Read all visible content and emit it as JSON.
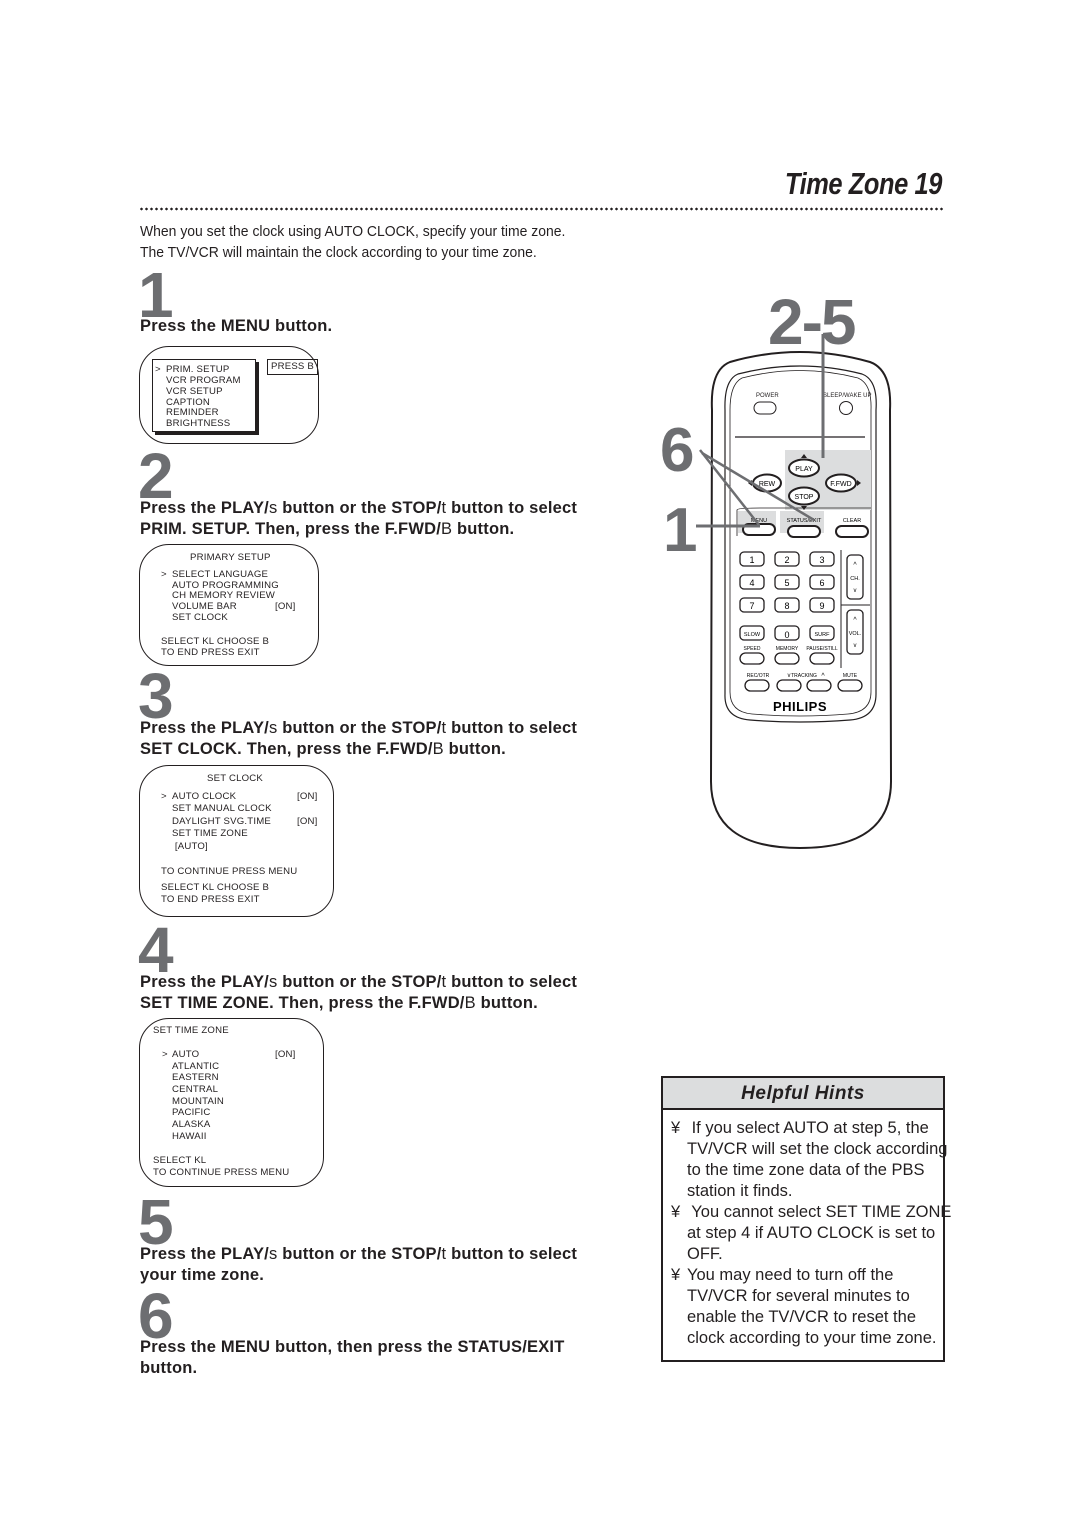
{
  "page": {
    "title": "Time Zone  19",
    "intro": [
      "When you set the clock using AUTO CLOCK, specify your time zone.",
      "The TV/VCR will maintain the clock according to your time zone."
    ]
  },
  "steps": [
    {
      "number": "1",
      "instruction_lines": [
        [
          "Press the MENU button."
        ]
      ],
      "screen": {
        "items": [
          "PRIM. SETUP",
          "VCR PROGRAM",
          "VCR SETUP",
          "CAPTION",
          "REMINDER",
          "BRIGHTNESS"
        ],
        "cursor": ">",
        "side_label": "PRESS B"
      }
    },
    {
      "number": "2",
      "instruction_lines": [
        [
          "Press the PLAY/",
          "s",
          "  button or the STOP/",
          "t",
          "  button to select"
        ],
        [
          "PRIM. SETUP.  Then, press the F.FWD/",
          "B",
          "  button."
        ]
      ],
      "screen": {
        "title": "PRIMARY SETUP",
        "cursor": ">",
        "items": [
          {
            "label": "SELECT LANGUAGE",
            "value": ""
          },
          {
            "label": "AUTO PROGRAMMING",
            "value": ""
          },
          {
            "label": "CH MEMORY REVIEW",
            "value": ""
          },
          {
            "label": "VOLUME BAR",
            "value": "[ON]"
          },
          {
            "label": "SET CLOCK",
            "value": ""
          }
        ],
        "footer": [
          "SELECT KL  CHOOSE B",
          "TO  END  PRESS  EXIT"
        ]
      }
    },
    {
      "number": "3",
      "instruction_lines": [
        [
          "Press the PLAY/",
          "s",
          "  button or the STOP/",
          "t",
          "  button to select"
        ],
        [
          "SET CLOCK. Then, press the F.FWD/",
          "B",
          "  button."
        ]
      ],
      "screen": {
        "title": "SET CLOCK",
        "cursor": ">",
        "items": [
          {
            "label": "AUTO CLOCK",
            "value": "[ON]"
          },
          {
            "label": "SET MANUAL CLOCK",
            "value": ""
          },
          {
            "label": "DAYLIGHT SVG.TIME",
            "value": "[ON]"
          },
          {
            "label": "SET TIME ZONE",
            "value": ""
          },
          {
            "label": " [AUTO]",
            "value": ""
          }
        ],
        "continue": "TO CONTINUE PRESS MENU",
        "footer": [
          "SELECT KL  CHOOSE B",
          "TO  END  PRESS  EXIT"
        ]
      }
    },
    {
      "number": "4",
      "instruction_lines": [
        [
          "Press the PLAY/",
          "s",
          "  button or the STOP/",
          "t",
          "  button to select"
        ],
        [
          "SET TIME ZONE. Then, press the F.FWD/",
          "B",
          "  button."
        ]
      ],
      "screen": {
        "title": "SET TIME ZONE",
        "cursor": ">",
        "items": [
          {
            "label": "AUTO",
            "value": "[ON]"
          },
          {
            "label": "ATLANTIC",
            "value": ""
          },
          {
            "label": "EASTERN",
            "value": ""
          },
          {
            "label": "CENTRAL",
            "value": ""
          },
          {
            "label": "MOUNTAIN",
            "value": ""
          },
          {
            "label": "PACIFIC",
            "value": ""
          },
          {
            "label": "ALASKA",
            "value": ""
          },
          {
            "label": "HAWAII",
            "value": ""
          }
        ],
        "footer": [
          "SELECT KL",
          "TO CONTINUE PRESS MENU"
        ]
      }
    },
    {
      "number": "5",
      "instruction_lines": [
        [
          "Press the PLAY/",
          "s",
          "  button or the STOP/",
          "t",
          "  button to select"
        ],
        [
          "your time zone."
        ]
      ]
    },
    {
      "number": "6",
      "instruction_lines": [
        [
          "Press the MENU button, then press the STATUS/EXIT"
        ],
        [
          "button."
        ]
      ]
    }
  ],
  "remote": {
    "callouts": {
      "steps_2_5": "2-5",
      "step_6": "6",
      "step_1": "1"
    },
    "brand": "PHILIPS",
    "top_labels": {
      "power": "POWER",
      "sleep": "SLEEP/WAKE UP"
    },
    "transport": {
      "play": "PLAY",
      "rew": "REW",
      "ffwd": "F.FWD",
      "stop": "STOP"
    },
    "function_row": {
      "menu": "MENU",
      "status": "STATUS/EXIT",
      "clear": "CLEAR"
    },
    "digits": [
      "1",
      "2",
      "3",
      "4",
      "5",
      "6",
      "7",
      "8",
      "9"
    ],
    "bottom_keys": {
      "slow": "SLOW",
      "zero": "0",
      "surf": "SURF"
    },
    "rockers": {
      "ch": "CH.",
      "vol": "VOL."
    },
    "labels_row1": {
      "speed": "SPEED",
      "memory": "MEMORY",
      "pause": "PAUSE/STILL"
    },
    "labels_row2": {
      "rec": "REC/OTR",
      "tracking": "TRACKING",
      "mute": "MUTE"
    },
    "colors": {
      "highlight": "#dcddde",
      "callout": "#6d6e71"
    }
  },
  "hints": {
    "title": "Helpful Hints",
    "bullet": "¥",
    "items": [
      [
        " If you select AUTO at step 5, the",
        "TV/VCR will set the clock according",
        "to the time zone data of the PBS",
        "station it finds."
      ],
      [
        " You cannot select SET TIME ZONE",
        "at step 4 if AUTO CLOCK is set to",
        "OFF."
      ],
      [
        "You may need to turn off the",
        "TV/VCR for several minutes to",
        "enable the TV/VCR to reset the",
        "clock according to your time zone."
      ]
    ]
  }
}
